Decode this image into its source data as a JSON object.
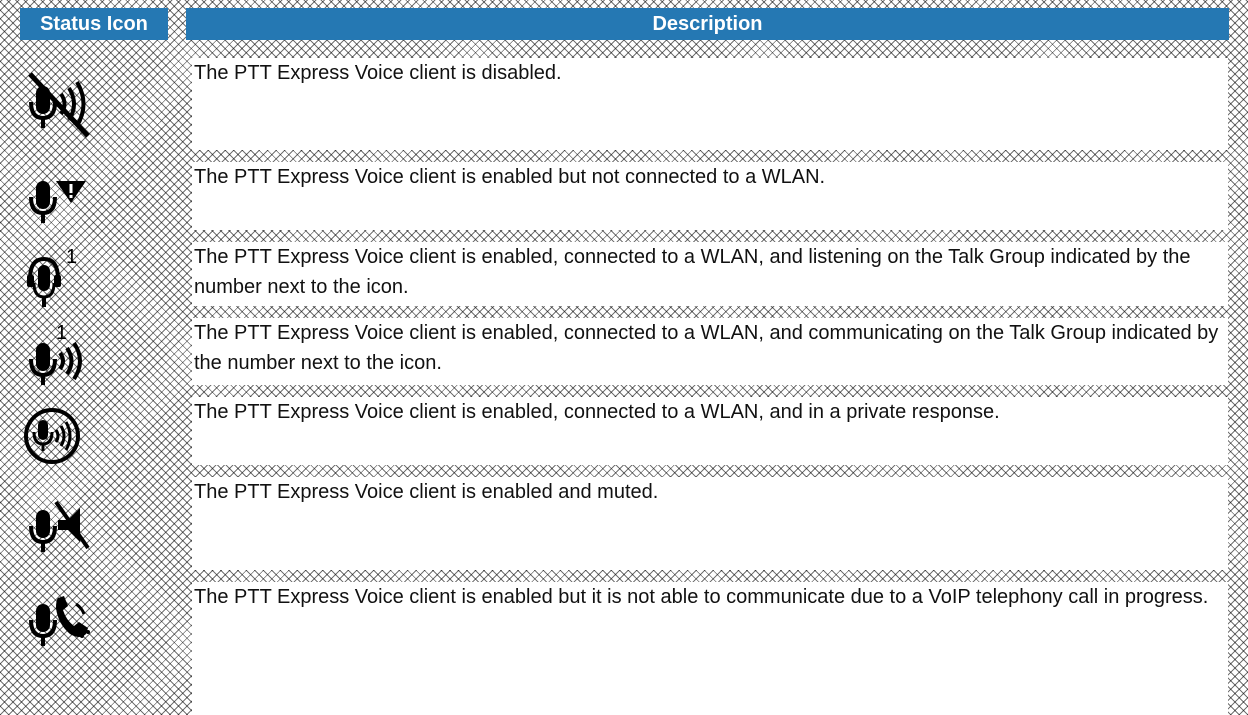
{
  "table": {
    "headers": {
      "status_icon": "Status Icon",
      "description": "Description"
    },
    "rows": [
      {
        "icon": "mic-speaker-disabled-icon",
        "description": "The PTT Express Voice client is disabled."
      },
      {
        "icon": "mic-warning-icon",
        "description": "The PTT Express Voice client is enabled but not connected to a WLAN."
      },
      {
        "icon": "mic-headset-listening-icon",
        "talk_group": "1",
        "description": "The PTT Express Voice client is enabled, connected to a WLAN, and listening on the Talk Group indicated by the number next to the icon."
      },
      {
        "icon": "mic-communicating-icon",
        "talk_group": "1",
        "description": "The PTT Express Voice client is enabled, connected to a WLAN, and communicating on the Talk Group indicated by the number next to the icon."
      },
      {
        "icon": "mic-private-response-icon",
        "description": "The PTT Express Voice client is enabled, connected to a WLAN, and in a private response."
      },
      {
        "icon": "mic-muted-icon",
        "description": "The PTT Express Voice client is enabled and muted."
      },
      {
        "icon": "mic-voip-call-icon",
        "description": "The PTT Express Voice client is enabled but it is not able to communicate due to a VoIP telephony call in progress."
      }
    ]
  }
}
